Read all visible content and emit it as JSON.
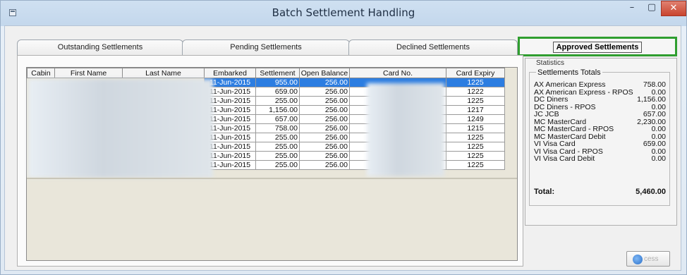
{
  "window": {
    "title": "Batch Settlement Handling",
    "minimize_glyph": "–",
    "maximize_glyph": "▢",
    "close_glyph": "✕"
  },
  "tabs": [
    {
      "label": "Outstanding Settlements"
    },
    {
      "label": "Pending Settlements"
    },
    {
      "label": "Declined Settlements"
    },
    {
      "label": "Approved Settlements",
      "active": true
    }
  ],
  "grid": {
    "columns": [
      "Cabin",
      "First Name",
      "Last Name",
      "Embarked",
      "Settlement",
      "Open Balance",
      "Card No.",
      "Card Expiry"
    ],
    "rows": [
      {
        "embarked": "11-Jun-2015",
        "settlement": "955.00",
        "open_balance": "256.00",
        "card_expiry": "1225"
      },
      {
        "embarked": "11-Jun-2015",
        "settlement": "659.00",
        "open_balance": "256.00",
        "card_expiry": "1222"
      },
      {
        "embarked": "11-Jun-2015",
        "settlement": "255.00",
        "open_balance": "256.00",
        "card_expiry": "1225"
      },
      {
        "embarked": "11-Jun-2015",
        "settlement": "1,156.00",
        "open_balance": "256.00",
        "card_expiry": "1217"
      },
      {
        "embarked": "11-Jun-2015",
        "settlement": "657.00",
        "open_balance": "256.00",
        "card_expiry": "1249"
      },
      {
        "embarked": "11-Jun-2015",
        "settlement": "758.00",
        "open_balance": "256.00",
        "card_expiry": "1215"
      },
      {
        "embarked": "11-Jun-2015",
        "settlement": "255.00",
        "open_balance": "256.00",
        "card_expiry": "1225"
      },
      {
        "embarked": "11-Jun-2015",
        "settlement": "255.00",
        "open_balance": "256.00",
        "card_expiry": "1225"
      },
      {
        "embarked": "11-Jun-2015",
        "settlement": "255.00",
        "open_balance": "256.00",
        "card_expiry": "1225"
      },
      {
        "embarked": "11-Jun-2015",
        "settlement": "255.00",
        "open_balance": "256.00",
        "card_expiry": "1225"
      }
    ]
  },
  "statistics": {
    "group_label": "Statistics",
    "totals_caption": "Settlements Totals",
    "items": [
      {
        "label": "AX  American Express",
        "value": "758.00"
      },
      {
        "label": "AX  American Express - RPOS",
        "value": "0.00"
      },
      {
        "label": "DC  Diners",
        "value": "1,156.00"
      },
      {
        "label": "DC  Diners - RPOS",
        "value": "0.00"
      },
      {
        "label": "JC  JCB",
        "value": "657.00"
      },
      {
        "label": "MC  MasterCard",
        "value": "2,230.00"
      },
      {
        "label": "MC  MasterCard - RPOS",
        "value": "0.00"
      },
      {
        "label": "MC  MasterCard Debit",
        "value": "0.00"
      },
      {
        "label": "VI  Visa Card",
        "value": "659.00"
      },
      {
        "label": "VI  Visa Card - RPOS",
        "value": "0.00"
      },
      {
        "label": "VI  Visa Card Debit",
        "value": "0.00"
      }
    ],
    "total_label": "Total:",
    "total_value": "5,460.00"
  },
  "process_button": {
    "label": "cess"
  }
}
